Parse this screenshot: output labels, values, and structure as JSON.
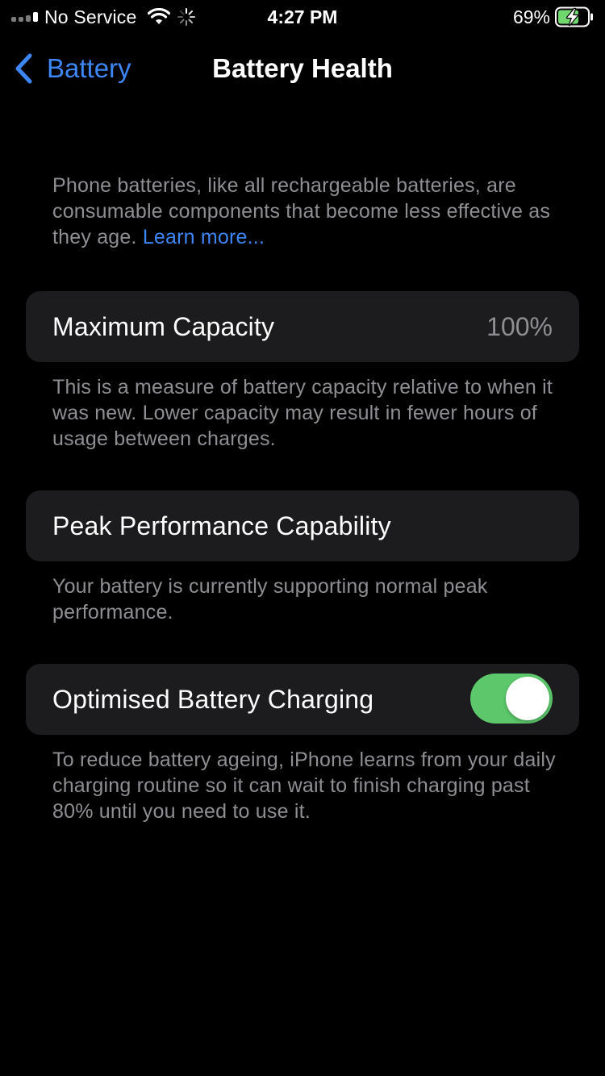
{
  "status_bar": {
    "carrier": "No Service",
    "time": "4:27 PM",
    "battery_percent": "69%",
    "charging": true,
    "signal_icon": "signal-bars-icon",
    "wifi_icon": "wifi-icon",
    "activity_icon": "activity-spinner-icon",
    "battery_icon": "battery-charging-icon"
  },
  "nav": {
    "back_label": "Battery",
    "back_icon": "chevron-left-icon",
    "title": "Battery Health"
  },
  "intro": {
    "text": "Phone batteries, like all rechargeable batteries, are consumable components that become less effective as they age. ",
    "link": "Learn more..."
  },
  "max_capacity": {
    "label": "Maximum Capacity",
    "value": "100%",
    "footer": "This is a measure of battery capacity relative to when it was new. Lower capacity may result in fewer hours of usage between charges."
  },
  "peak_performance": {
    "label": "Peak Performance Capability",
    "footer": "Your battery is currently supporting normal peak performance."
  },
  "optimised_charging": {
    "label": "Optimised Battery Charging",
    "enabled": true,
    "footer": "To reduce battery ageing, iPhone learns from your daily charging routine so it can wait to finish charging past 80% until you need to use it."
  },
  "colors": {
    "background": "#000000",
    "cell_background": "#1c1c1e",
    "secondary_text": "#8e8e93",
    "accent": "#3d86f5",
    "toggle_on": "#5cc76b",
    "battery_fill": "#6fd86f"
  }
}
